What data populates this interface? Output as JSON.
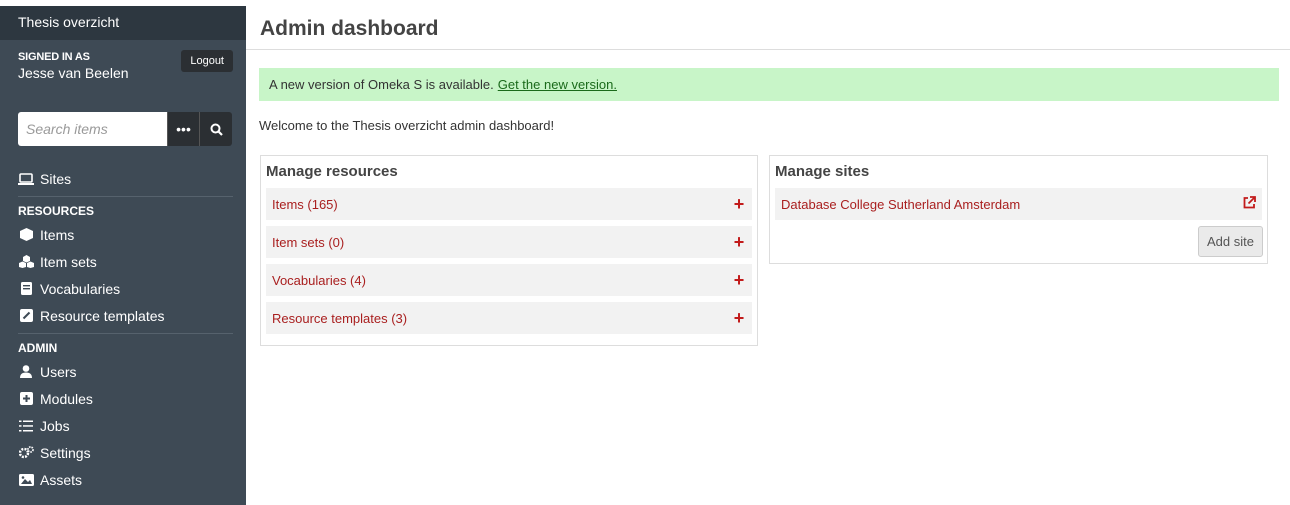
{
  "sidebar": {
    "site_title": "Thesis overzicht",
    "signed_in_label": "SIGNED IN AS",
    "user_name": "Jesse van Beelen",
    "logout_label": "Logout",
    "search_placeholder": "Search items",
    "nav": {
      "sites": "Sites",
      "resources_heading": "RESOURCES",
      "items": "Items",
      "item_sets": "Item sets",
      "vocabularies": "Vocabularies",
      "resource_templates": "Resource templates",
      "admin_heading": "ADMIN",
      "users": "Users",
      "modules": "Modules",
      "jobs": "Jobs",
      "settings": "Settings",
      "assets": "Assets"
    }
  },
  "main": {
    "page_title": "Admin dashboard",
    "notice_text": "A new version of Omeka S is available.",
    "notice_link": "Get the new version.",
    "welcome_text": "Welcome to the Thesis overzicht admin dashboard!",
    "manage_resources": {
      "title": "Manage resources",
      "rows": [
        {
          "label": "Items (165)"
        },
        {
          "label": "Item sets (0)"
        },
        {
          "label": "Vocabularies (4)"
        },
        {
          "label": "Resource templates (3)"
        }
      ]
    },
    "manage_sites": {
      "title": "Manage sites",
      "sites": [
        {
          "label": "Database College Sutherland Amsterdam"
        }
      ],
      "add_site_label": "Add site"
    }
  },
  "colors": {
    "sidebar_bg": "#3e4a55",
    "link_red": "#a91f1f",
    "notice_bg": "#c8f5c8"
  }
}
